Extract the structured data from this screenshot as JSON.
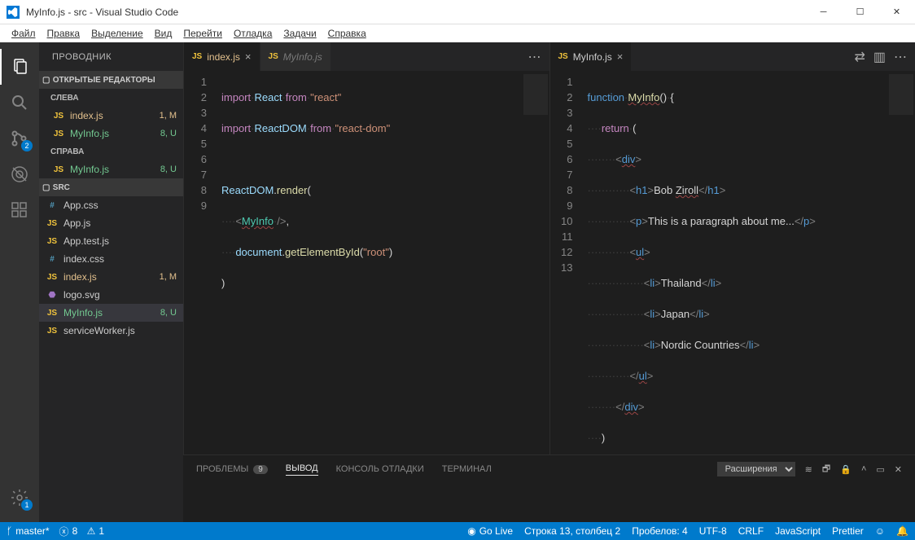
{
  "title": "MyInfo.js - src - Visual Studio Code",
  "menubar": [
    "Файл",
    "Правка",
    "Выделение",
    "Вид",
    "Перейти",
    "Отладка",
    "Задачи",
    "Справка"
  ],
  "activitybar": {
    "scm_badge": "2",
    "settings_badge": "1"
  },
  "sidebar": {
    "header": "ПРОВОДНИК",
    "open_editors": "ОТКРЫТЫЕ РЕДАКТОРЫ",
    "left": "СЛЕВА",
    "right": "СПРАВА",
    "src": "SRC",
    "left_items": [
      {
        "icon": "JS",
        "name": "index.js",
        "status": "1, M",
        "cls": "mod"
      },
      {
        "icon": "JS",
        "name": "MyInfo.js",
        "status": "8, U",
        "cls": "untracked"
      }
    ],
    "right_items": [
      {
        "icon": "JS",
        "name": "MyInfo.js",
        "status": "8, U",
        "cls": "untracked"
      }
    ],
    "src_items": [
      {
        "icon": "#",
        "name": "App.css",
        "ico": "hash"
      },
      {
        "icon": "JS",
        "name": "App.js",
        "ico": "js"
      },
      {
        "icon": "JS",
        "name": "App.test.js",
        "ico": "js"
      },
      {
        "icon": "#",
        "name": "index.css",
        "ico": "hash"
      },
      {
        "icon": "JS",
        "name": "index.js",
        "ico": "js",
        "status": "1, M",
        "cls": "mod"
      },
      {
        "icon": "⬣",
        "name": "logo.svg",
        "ico": "svg"
      },
      {
        "icon": "JS",
        "name": "MyInfo.js",
        "ico": "js",
        "status": "8, U",
        "cls": "untracked",
        "selected": true
      },
      {
        "icon": "JS",
        "name": "serviceWorker.js",
        "ico": "js"
      }
    ]
  },
  "editor_left": {
    "tabs": [
      {
        "icon": "JS",
        "name": "index.js",
        "cls": "mod",
        "active": true
      },
      {
        "icon": "JS",
        "name": "MyInfo.js",
        "cls": "dim"
      }
    ],
    "lines": [
      "1",
      "2",
      "3",
      "4",
      "5",
      "6",
      "7",
      "8",
      "9"
    ]
  },
  "editor_right": {
    "tabs": [
      {
        "icon": "JS",
        "name": "MyInfo.js",
        "active": true
      }
    ],
    "lines": [
      "1",
      "2",
      "3",
      "4",
      "5",
      "6",
      "7",
      "8",
      "9",
      "10",
      "11",
      "12",
      "13"
    ]
  },
  "panel": {
    "tabs": [
      "ПРОБЛЕМЫ",
      "ВЫВОД",
      "КОНСОЛЬ ОТЛАДКИ",
      "ТЕРМИНАЛ"
    ],
    "problems_count": "9",
    "active": 1,
    "dropdown": "Расширения"
  },
  "statusbar": {
    "branch": "master*",
    "errors": "8",
    "warnings": "1",
    "golive": "Go Live",
    "position": "Строка 13, столбец 2",
    "spaces": "Пробелов: 4",
    "encoding": "UTF-8",
    "eol": "CRLF",
    "lang": "JavaScript",
    "prettier": "Prettier"
  }
}
